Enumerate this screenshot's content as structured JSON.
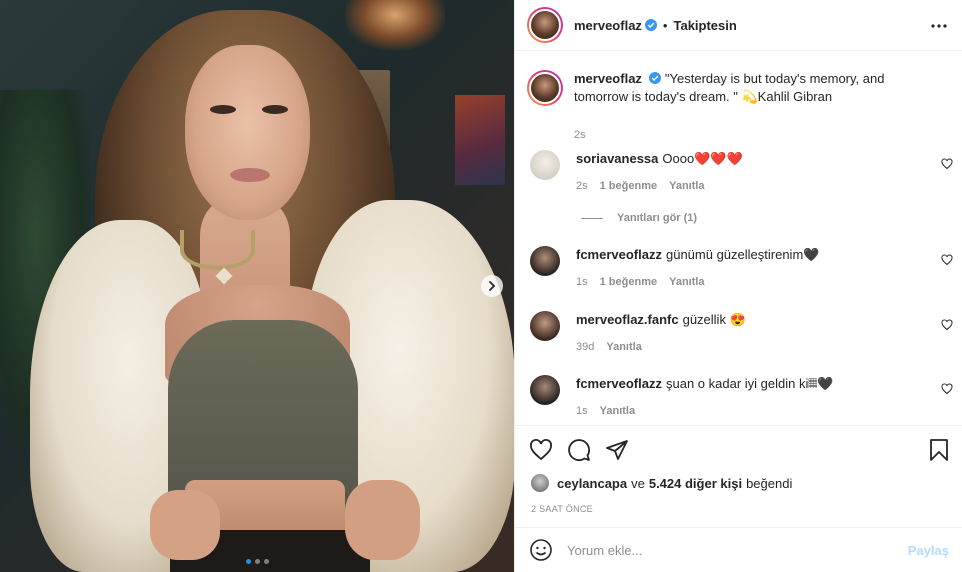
{
  "post": {
    "username": "merveoflaz",
    "follow_state": "Takiptesin",
    "separator": "•",
    "caption": "\"Yesterday is but today's memory, and tomorrow is today's dream. \" 💫Kahlil Gibran",
    "caption_time": "2s",
    "carousel": {
      "dot_count": 3,
      "active_index": 0
    }
  },
  "comments": [
    {
      "user": "soriavanessa",
      "text": "Oooo❤️❤️❤️",
      "time": "2s",
      "likes": "1 beğenme",
      "reply": "Yanıtla",
      "view_replies": "Yanıtları gör (1)"
    },
    {
      "user": "fcmerveoflazz",
      "text": "günümü güzelleştirenim🖤",
      "time": "1s",
      "likes": "1 beğenme",
      "reply": "Yanıtla"
    },
    {
      "user": "merveoflaz.fanfc",
      "text": "güzellik 😍",
      "time": "39d",
      "reply": "Yanıtla"
    },
    {
      "user": "fcmerveoflazz",
      "text": "şuan o kadar iyi geldin ki𝄜🖤",
      "time": "1s",
      "reply": "Yanıtla"
    }
  ],
  "likes": {
    "first_user": "ceylancapa",
    "connector": "ve",
    "others": "5.424 diğer kişi",
    "suffix": "beğendi"
  },
  "post_time": "2 SAAT ÖNCE",
  "add_comment": {
    "placeholder": "Yorum ekle...",
    "post_label": "Paylaş"
  },
  "colors": {
    "verified": "#3897f0",
    "link_muted": "#8e8e8e",
    "post_button": "#b3dbff",
    "active_dot": "#1a95e0"
  },
  "icons": [
    "verified-icon",
    "more-icon",
    "heart-icon",
    "comment-icon",
    "share-icon",
    "bookmark-icon",
    "emoji-icon",
    "chevron-right-icon"
  ]
}
